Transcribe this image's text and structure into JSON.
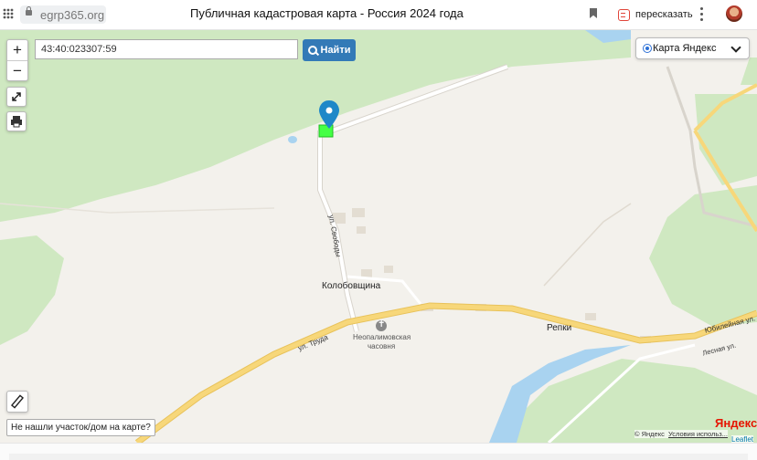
{
  "browser": {
    "url": "egrp365.org",
    "page_title": "Публичная кадастровая карта - Россия 2024 года",
    "retell_label": "пересказать"
  },
  "search": {
    "value": "43:40:023307:59",
    "button_label": "Найти"
  },
  "zoom": {
    "in_label": "+",
    "out_label": "−"
  },
  "layer": {
    "selected": "Карта Яндекс"
  },
  "map_labels": {
    "village": "Колобовщина",
    "village2": "Репки",
    "street_svobody": "ул. Свободы",
    "street_truda": "ул. Труда",
    "street_yubileynaya": "Юбилейная ул.",
    "street_lesnaya": "Лесная ул.",
    "chapel_line1": "Неопалимовская",
    "chapel_line2": "часовня"
  },
  "not_found_label": "Не нашли участок/дом на карте?",
  "attribution": {
    "yandex_logo": "Яндекс",
    "copyright": "© Яндекс",
    "terms": "Условия использ...",
    "leaflet": "Leaflet"
  },
  "colors": {
    "forest": "#cfe8c1",
    "road_yellow": "#f7d77a",
    "water": "#a9d3f0",
    "marker": "#1e88c8",
    "parcel": "#44ff44",
    "button": "#337ab7"
  }
}
